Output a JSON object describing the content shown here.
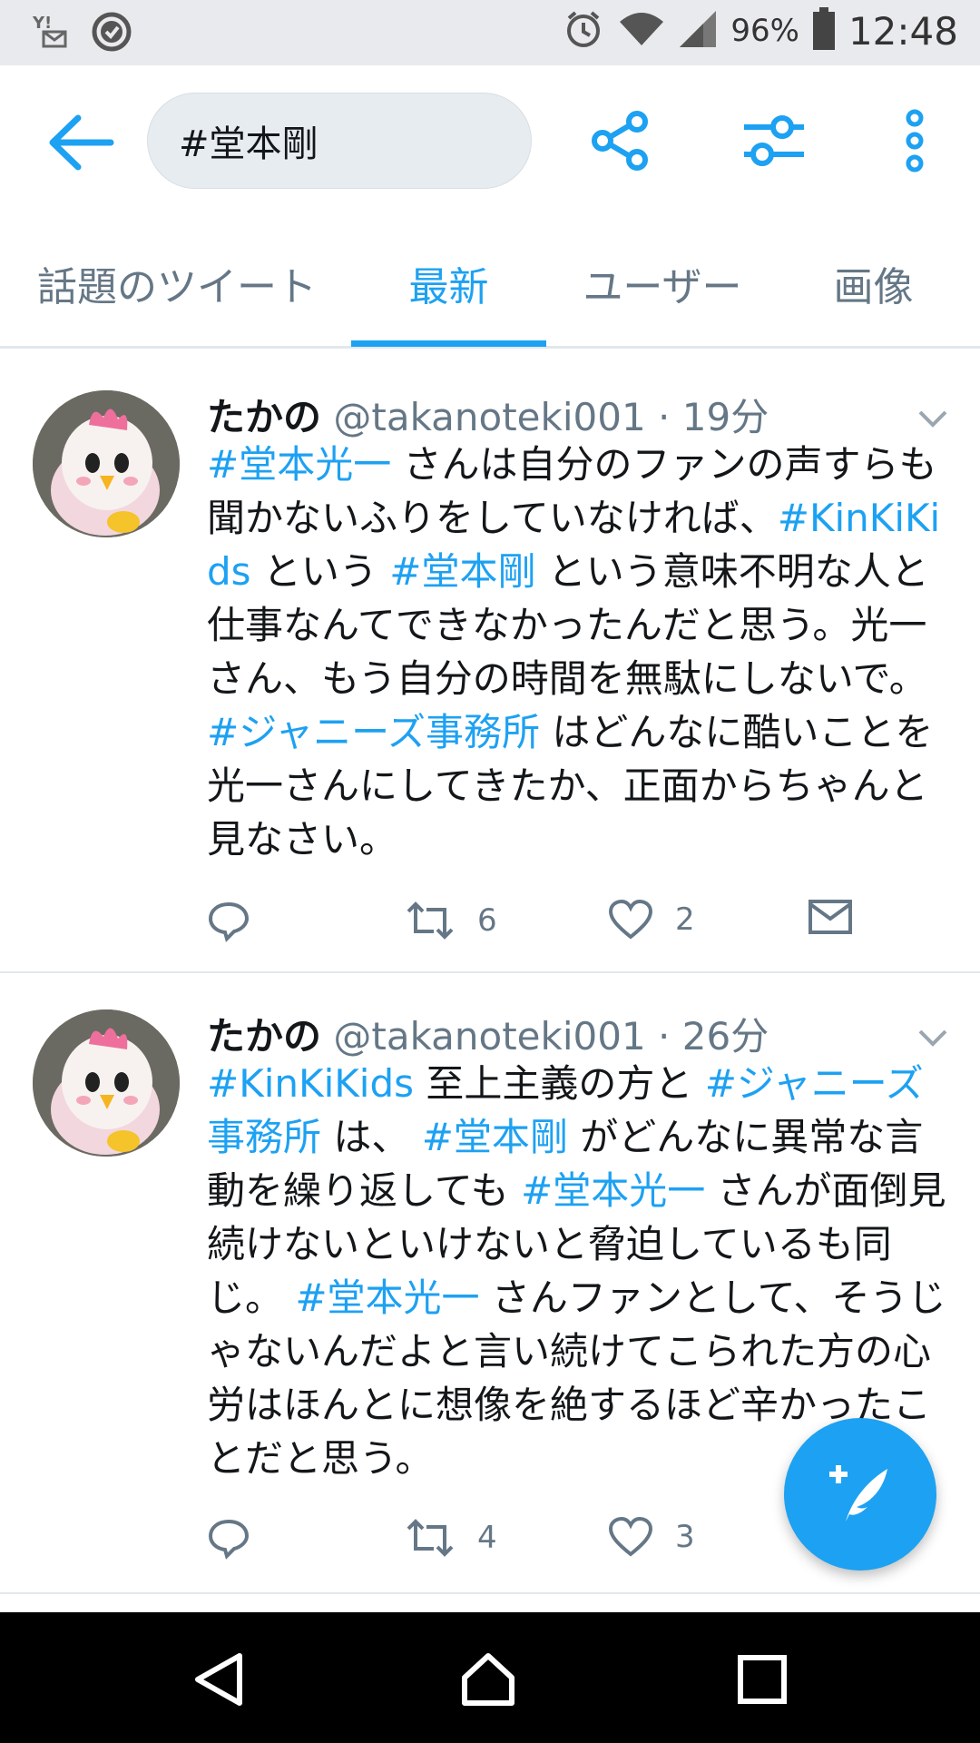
{
  "status_bar": {
    "battery_percent": "96%",
    "time": "12:48",
    "icons": [
      "yahoo-mail-icon",
      "check-circle-icon",
      "alarm-icon",
      "wifi-icon",
      "signal-icon",
      "battery-icon"
    ]
  },
  "app_bar": {
    "search_query": "#堂本剛",
    "icons": [
      "back-arrow-icon",
      "share-icon",
      "filter-icon",
      "more-vert-icon"
    ],
    "accent_color": "#1da1f2"
  },
  "tabs": [
    {
      "label": "話題のツイート",
      "active": false
    },
    {
      "label": "最新",
      "active": true
    },
    {
      "label": "ユーザー",
      "active": false
    },
    {
      "label": "画像",
      "active": false
    }
  ],
  "tweets": [
    {
      "name": "たかの",
      "handle": "@takanoteki001",
      "time": "· 19分",
      "text_parts": [
        {
          "t": "#堂本光一",
          "tag": true
        },
        {
          "t": " さんは自分のファンの声すらも聞かないふりをしていなければ、",
          "tag": false
        },
        {
          "t": "#KinKiKids",
          "tag": true
        },
        {
          "t": " という ",
          "tag": false
        },
        {
          "t": "#堂本剛",
          "tag": true
        },
        {
          "t": " という意味不明な人と仕事なんてできなかったんだと思う。光一さん、もう自分の時間を無駄にしないで。 ",
          "tag": false
        },
        {
          "t": "#ジャニーズ事務所",
          "tag": true
        },
        {
          "t": " はどんなに酷いことを光一さんにしてきたか、正面からちゃんと見なさい。",
          "tag": false
        }
      ],
      "retweets": "6",
      "likes": "2"
    },
    {
      "name": "たかの",
      "handle": "@takanoteki001",
      "time": "· 26分",
      "text_parts": [
        {
          "t": "#KinKiKids",
          "tag": true
        },
        {
          "t": " 至上主義の方と ",
          "tag": false
        },
        {
          "t": "#ジャニーズ事務所",
          "tag": true
        },
        {
          "t": " は、 ",
          "tag": false
        },
        {
          "t": "#堂本剛",
          "tag": true
        },
        {
          "t": " がどんなに異常な言動を繰り返しても ",
          "tag": false
        },
        {
          "t": "#堂本光一",
          "tag": true
        },
        {
          "t": " さんが面倒見続けないといけないと脅迫しているも同じ。 ",
          "tag": false
        },
        {
          "t": "#堂本光一",
          "tag": true
        },
        {
          "t": " さんファンとして、そうじゃないんだよと言い続けてこられた方の心労はほんとに想像を絶するほど辛かったことだと思う。",
          "tag": false
        }
      ],
      "retweets": "4",
      "likes": "3"
    }
  ]
}
